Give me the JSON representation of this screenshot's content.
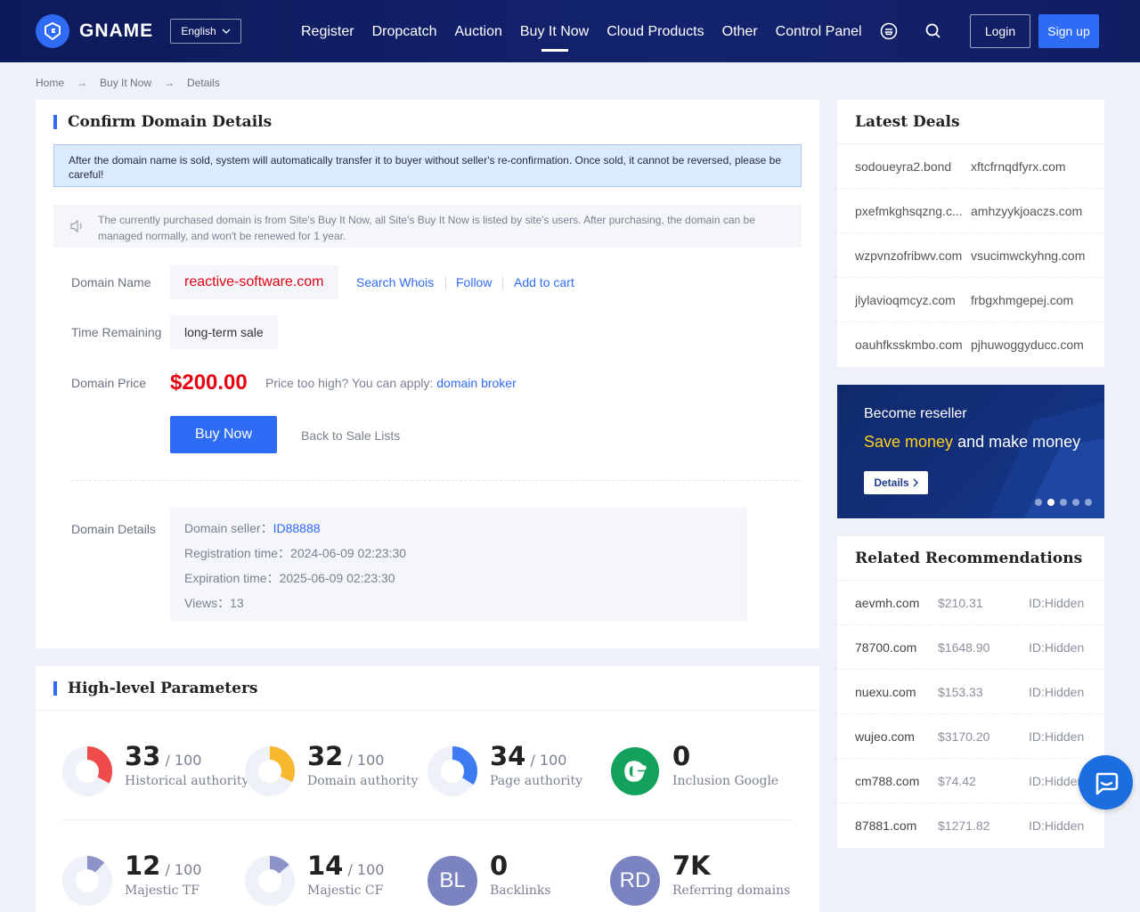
{
  "header": {
    "brand": "GNAME",
    "language": "English",
    "nav": [
      "Register",
      "Dropcatch",
      "Auction",
      "Buy It Now",
      "Cloud Products",
      "Other",
      "Control Panel"
    ],
    "login": "Login",
    "signup": "Sign up"
  },
  "breadcrumb": [
    "Home",
    "Buy It Now",
    "Details"
  ],
  "confirm": {
    "title": "Confirm Domain Details",
    "notice": "After the domain name is sold, system will automatically transfer it to buyer without seller's re-confirmation. Once sold, it cannot be reversed, please be careful!",
    "info": "The currently purchased domain is from Site's Buy It Now, all Site's Buy It Now is listed by site's users. After purchasing, the domain can be managed normally, and won't be renewed for 1 year.",
    "domain_label": "Domain Name",
    "domain": "reactive-software.com",
    "search_whois": "Search Whois",
    "follow": "Follow",
    "add_to_cart": "Add to cart",
    "time_label": "Time Remaining",
    "time_value": "long-term sale",
    "price_label": "Domain Price",
    "price": "$200.00",
    "price_note": "Price too high? You can apply:",
    "broker": "domain broker",
    "buy_now": "Buy Now",
    "back": "Back to Sale Lists",
    "details_label": "Domain Details",
    "seller_label": "Domain seller：",
    "seller": "ID88888",
    "reg_label": "Registration time：",
    "reg": "2024-06-09 02:23:30",
    "exp_label": "Expiration time：",
    "exp": "2025-06-09 02:23:30",
    "views_label": "Views：",
    "views": "13"
  },
  "params": {
    "title": "High-level Parameters",
    "out_of": "/ 100",
    "metrics": [
      {
        "value": "33",
        "label": "Historical authority",
        "pct": 33,
        "color": "#f04b4b"
      },
      {
        "value": "32",
        "label": "Domain authority",
        "pct": 32,
        "color": "#f5b82e"
      },
      {
        "value": "34",
        "label": "Page authority",
        "pct": 34,
        "color": "#3e7bf2"
      },
      {
        "value": "0",
        "label": "Inclusion Google"
      },
      {
        "value": "12",
        "label": "Majestic TF",
        "pct": 12,
        "color": "#8b93c9"
      },
      {
        "value": "14",
        "label": "Majestic CF",
        "pct": 14,
        "color": "#8b93c9"
      },
      {
        "value": "0",
        "label": "Backlinks",
        "badge": "BL"
      },
      {
        "value": "7K",
        "label": "Referring domains",
        "badge": "RD"
      }
    ]
  },
  "latest": {
    "title": "Latest Deals",
    "rows": [
      [
        "sodoueyra2.bond",
        "xftcfrnqdfyrx.com"
      ],
      [
        "pxefmkghsqzng.c...",
        "amhzyykjoaczs.com"
      ],
      [
        "wzpvnzofribwv.com",
        "vsucimwckyhng.com"
      ],
      [
        "jlylavioqmcyz.com",
        "frbgxhmgepej.com"
      ],
      [
        "oauhfksskmbo.com",
        "pjhuwoggyducc.com"
      ]
    ]
  },
  "banner": {
    "line1": "Become reseller",
    "save": "Save money",
    "rest": " and make money",
    "button": "Details"
  },
  "related": {
    "title": "Related Recommendations",
    "rows": [
      [
        "aevmh.com",
        "$210.31",
        "ID:Hidden"
      ],
      [
        "78700.com",
        "$1648.90",
        "ID:Hidden"
      ],
      [
        "nuexu.com",
        "$153.33",
        "ID:Hidden"
      ],
      [
        "wujeo.com",
        "$3170.20",
        "ID:Hidden"
      ],
      [
        "cm788.com",
        "$74.42",
        "ID:Hidden"
      ],
      [
        "87881.com",
        "$1271.82",
        "ID:Hidden"
      ]
    ]
  }
}
